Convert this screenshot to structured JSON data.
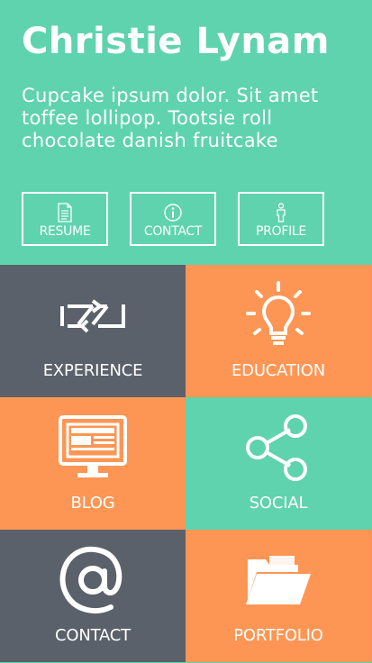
{
  "header": {
    "name": "Christie Lynam",
    "intro": "Cupcake ipsum dolor. Sit amet toffee lollipop. Tootsie roll chocolate danish fruitcake",
    "buttons": [
      {
        "label": "RESUME",
        "icon": "document-icon"
      },
      {
        "label": "CONTACT",
        "icon": "info-icon"
      },
      {
        "label": "PROFILE",
        "icon": "person-icon"
      }
    ]
  },
  "tiles": [
    {
      "label": "EXPERIENCE",
      "icon": "swap-arrows-icon",
      "color": "#5a616a"
    },
    {
      "label": "EDUCATION",
      "icon": "lightbulb-icon",
      "color": "#fd9654"
    },
    {
      "label": "BLOG",
      "icon": "monitor-icon",
      "color": "#fd9654"
    },
    {
      "label": "SOCIAL",
      "icon": "share-icon",
      "color": "#5fd3ad"
    },
    {
      "label": "CONTACT",
      "icon": "at-sign-icon",
      "color": "#5a616a"
    },
    {
      "label": "PORTFOLIO",
      "icon": "folder-icon",
      "color": "#fd9654"
    }
  ],
  "colors": {
    "green": "#5fd3ad",
    "orange": "#fd9654",
    "gray": "#5a616a",
    "text": "#ffffff"
  }
}
